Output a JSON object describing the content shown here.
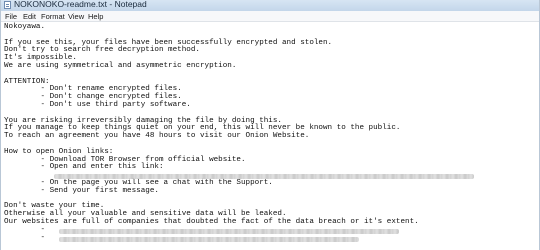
{
  "window": {
    "title": "NOKONOKO-readme.txt - Notepad",
    "icon": "notepad-icon"
  },
  "menu": [
    "File",
    "Edit",
    "Format",
    "View",
    "Help"
  ],
  "document": {
    "lines": [
      "Nokoyawa.",
      "",
      "If you see this, your files have been successfully encrypted and stolen.",
      "Don't try to search free decryption method.",
      "It's impossible.",
      "We are using symmetrical and asymmetric encryption.",
      "",
      "ATTENTION:",
      "        - Don't rename encrypted files.",
      "        - Don't change encrypted files.",
      "        - Don't use third party software.",
      "",
      "You are risking irreversibly damaging the file by doing this.",
      "If you manage to keep things quiet on your end, this will never be known to the public.",
      "To reach an agreement you have 48 hours to visit our Onion Website.",
      "",
      "How to open Onion links:",
      "        - Download TOR Browser from official website.",
      "        - Open and enter this link:",
      "",
      "        - On the page you will see a chat with the Support.",
      "        - Send your first message.",
      "",
      "Don't waste your time.",
      "Otherwise all your valuable and sensitive data will be leaked.",
      "Our websites are full of companies that doubted the fact of the data breach or it's extent.",
      "        -",
      "        -"
    ]
  }
}
